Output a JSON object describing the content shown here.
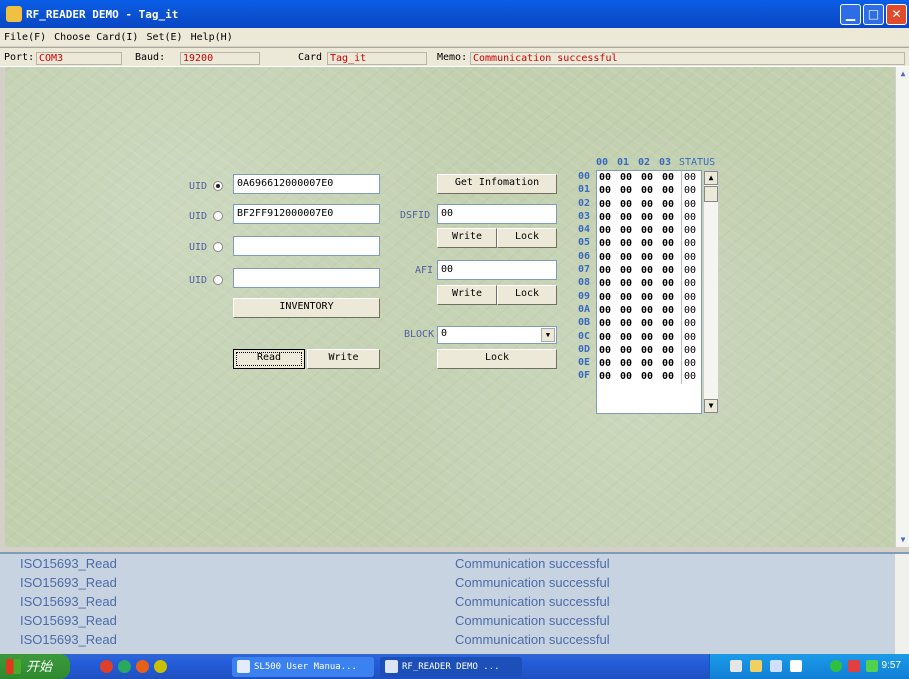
{
  "window": {
    "title": "RF_READER DEMO  -  Tag_it"
  },
  "menu": [
    "File(F)",
    "Choose Card(I)",
    "Set(E)",
    "Help(H)"
  ],
  "infobar": {
    "port_label": "Port:",
    "port_value": "COM3",
    "baud_label": "Baud:",
    "baud_value": "19200",
    "card_label": "Card",
    "card_value": "Tag_it",
    "memo_label": "Memo:",
    "memo_value": "Communication successful"
  },
  "uid": {
    "label": "UID",
    "rows": [
      {
        "value": "0A696612000007E0",
        "checked": true
      },
      {
        "value": "BF2FF912000007E0",
        "checked": false
      },
      {
        "value": "",
        "checked": false
      },
      {
        "value": "",
        "checked": false
      }
    ],
    "inventory_button": "INVENTORY",
    "read_button": "Read",
    "write_button": "Write"
  },
  "middle": {
    "get_info_button": "Get Infomation",
    "dsfid_label": "DSFID",
    "dsfid_value": "00",
    "afi_label": "AFI",
    "afi_value": "00",
    "write_label": "Write",
    "lock_label": "Lock",
    "block_label": "BLOCK",
    "block_value": "0",
    "block_lock_button": "Lock"
  },
  "grid": {
    "columns": [
      "00",
      "01",
      "02",
      "03"
    ],
    "status_header": "STATUS",
    "row_labels": [
      "00",
      "01",
      "02",
      "03",
      "04",
      "05",
      "06",
      "07",
      "08",
      "09",
      "0A",
      "0B",
      "0C",
      "0D",
      "0E",
      "0F"
    ],
    "cell_value": "00",
    "status_value": "00"
  },
  "log": [
    {
      "cmd": "ISO15693_Read",
      "result": "Communication successful"
    },
    {
      "cmd": "ISO15693_Read",
      "result": "Communication successful"
    },
    {
      "cmd": "ISO15693_Read",
      "result": "Communication successful"
    },
    {
      "cmd": "ISO15693_Read",
      "result": "Communication successful"
    },
    {
      "cmd": "ISO15693_Read",
      "result": "Communication successful"
    }
  ],
  "taskbar": {
    "start_label": "开始",
    "tasks": [
      "SL500 User Manua...",
      "RF_READER DEMO  ..."
    ],
    "clock": "9:57"
  },
  "colors": {
    "titlebar": "#0b54d6",
    "panel": "#c2d0b0",
    "accent_red": "#cc0000",
    "grid_label": "#3a6abf"
  }
}
